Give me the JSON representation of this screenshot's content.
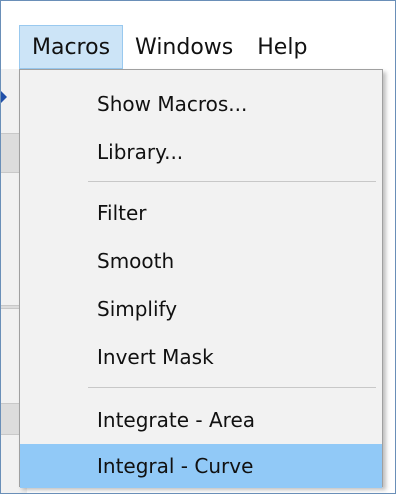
{
  "menubar": {
    "items": [
      "Macros",
      "Windows",
      "Help"
    ],
    "active_index": 0
  },
  "dropdown": {
    "groups": [
      [
        "Show Macros...",
        "Library..."
      ],
      [
        "Filter",
        "Smooth",
        "Simplify",
        "Invert Mask"
      ],
      [
        "Integrate - Area",
        "Integral - Curve"
      ]
    ],
    "highlighted": "Integral - Curve"
  },
  "colors": {
    "menubar_active_bg": "#cce4f7",
    "menubar_active_border": "#99c9ef",
    "menu_bg": "#f2f2f2",
    "item_highlight_bg": "#91c9f7",
    "frame_border": "#6a8fb8"
  }
}
